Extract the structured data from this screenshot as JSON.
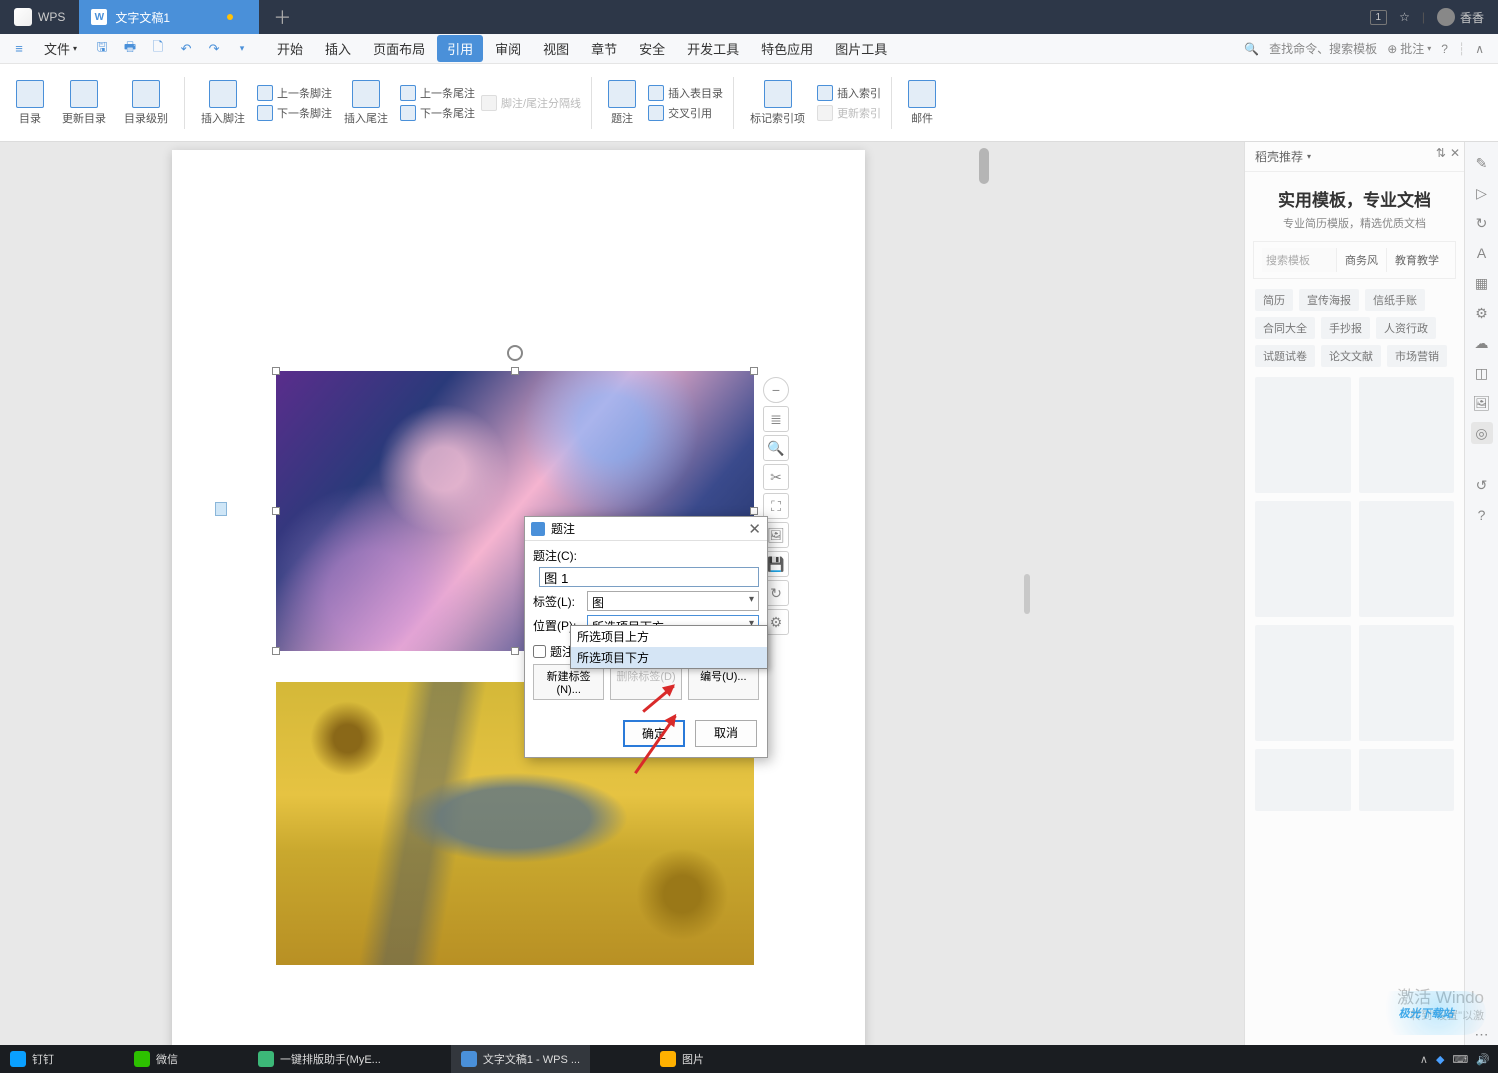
{
  "titlebar": {
    "app": "WPS",
    "tab_title": "文字文稿1",
    "pages_badge": "1",
    "user_name": "香香"
  },
  "menubar": {
    "file": "文件",
    "tabs": [
      "开始",
      "插入",
      "页面布局",
      "引用",
      "审阅",
      "视图",
      "章节",
      "安全",
      "开发工具",
      "特色应用",
      "图片工具"
    ],
    "active_index": 3,
    "search_placeholder": "查找命令、搜索模板",
    "annotate_btn": "批注"
  },
  "ribbon": {
    "toc": "目录",
    "update_toc": "更新目录",
    "toc_level": "目录级别",
    "insert_footnote": "插入脚注",
    "prev_footnote": "上一条脚注",
    "next_footnote": "下一条脚注",
    "insert_endnote": "插入尾注",
    "prev_endnote": "上一条尾注",
    "next_endnote": "下一条尾注",
    "fn_separator": "脚注/尾注分隔线",
    "caption": "题注",
    "insert_table_toc": "插入表目录",
    "cross_ref": "交叉引用",
    "mark_index": "标记索引项",
    "insert_index": "插入索引",
    "update_index": "更新索引",
    "mail": "邮件"
  },
  "dialog": {
    "title": "题注",
    "label_caption": "题注(C):",
    "value_caption": "图 1",
    "label_tag": "标签(L):",
    "value_tag": "图",
    "label_pos": "位置(P):",
    "value_pos": "所选项目下方",
    "dd_opt_above": "所选项目上方",
    "dd_opt_below": "所选项目下方",
    "check_includes": "题注中",
    "btn_new_label": "新建标签(N)...",
    "btn_del_label": "删除标签(D)",
    "btn_numbering": "编号(U)...",
    "ok": "确定",
    "cancel": "取消"
  },
  "sidepanel": {
    "header": "稻壳推荐",
    "title": "实用模板，专业文档",
    "subtitle": "专业简历模版，精选优质文档",
    "search_placeholder": "搜索模板",
    "search_tabs": [
      "商务风",
      "教育教学"
    ],
    "tags": [
      "简历",
      "宣传海报",
      "信纸手账",
      "合同大全",
      "手抄报",
      "人资行政",
      "试题试卷",
      "论文文献",
      "市场营销"
    ]
  },
  "activate": {
    "l1": "激活 Windo",
    "l2": "转到\"设置\"以激"
  },
  "watermark": "极光下载站",
  "taskbar": {
    "items": [
      {
        "label": "钉钉",
        "color": "#0aa0ff"
      },
      {
        "label": "微信",
        "color": "#2dc100"
      },
      {
        "label": "一键排版助手(MyE...",
        "color": "#3cb878"
      },
      {
        "label": "文字文稿1 - WPS ...",
        "color": "#4a90d9"
      },
      {
        "label": "图片",
        "color": "#ffb000"
      }
    ],
    "active_index": 3
  }
}
